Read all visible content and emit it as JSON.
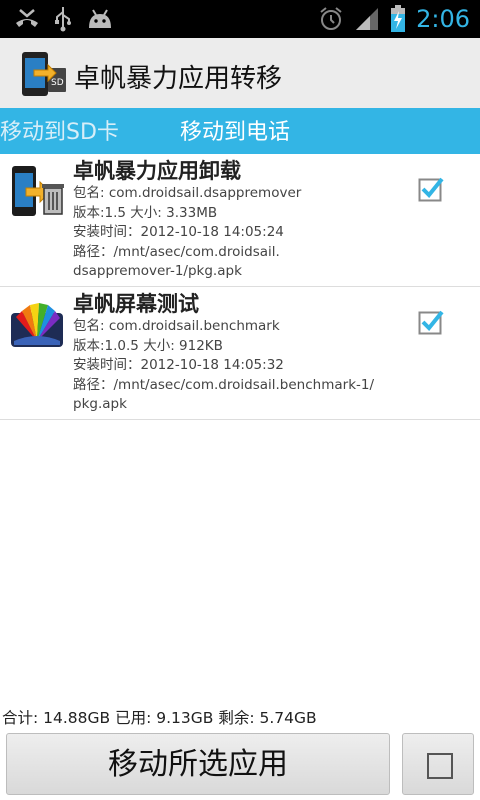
{
  "status_bar": {
    "time": "2:06",
    "icons": [
      "missed-call-icon",
      "usb-icon",
      "android-icon",
      "alarm-icon",
      "signal-icon",
      "battery-charging-icon"
    ]
  },
  "action_bar": {
    "title": "卓帆暴力应用转移",
    "icon": "phone-to-sd-icon"
  },
  "tabs": [
    {
      "label": "移动到SD卡",
      "selected": false
    },
    {
      "label": "移动到电话",
      "selected": true
    }
  ],
  "apps": [
    {
      "name": "卓帆暴力应用卸载",
      "package": "包名: com.droidsail.dsappremover",
      "version_size": "版本:1.5 大小: 3.33MB",
      "install_time": "安装时间：2012-10-18 14:05:24",
      "path_line1": "路径：/mnt/asec/com.droidsail.",
      "path_line2": "dsappremover-1/pkg.apk",
      "checked": true,
      "icon": "phone-trash-icon"
    },
    {
      "name": "卓帆屏幕测试",
      "package": "包名: com.droidsail.benchmark",
      "version_size": "版本:1.0.5 大小: 912KB",
      "install_time": "安装时间：2012-10-18 14:05:32",
      "path_line1": "路径：/mnt/asec/com.droidsail.benchmark-1/",
      "path_line2": "pkg.apk",
      "checked": true,
      "icon": "color-fan-icon"
    }
  ],
  "storage": "合计: 14.88GB 已用: 9.13GB 剩余: 5.74GB",
  "buttons": {
    "move_selected": "移动所选应用",
    "select_all_checked": false
  },
  "colors": {
    "accent": "#33b5e5",
    "status_bar_bg": "#000000",
    "action_bar_bg": "#ececec"
  }
}
